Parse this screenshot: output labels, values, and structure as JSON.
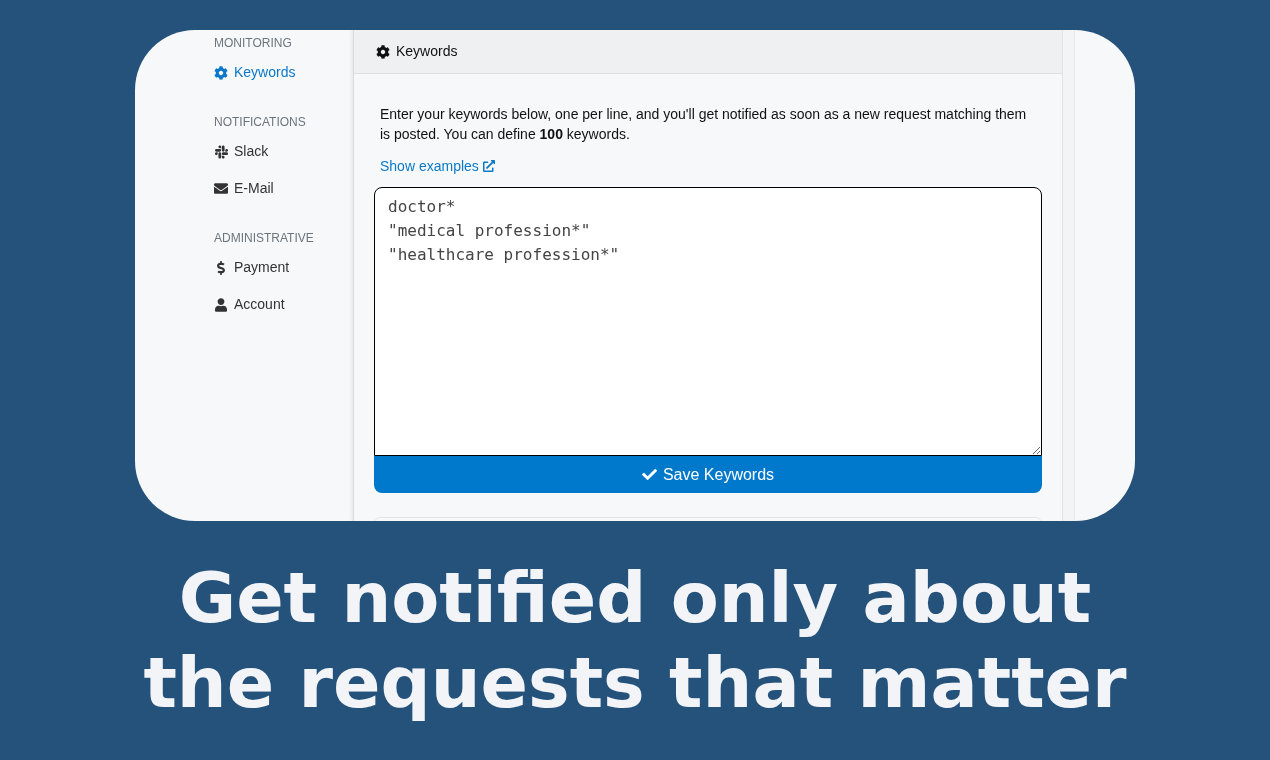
{
  "sidebar": {
    "sections": [
      {
        "heading": "MONITORING",
        "items": [
          {
            "label": "Keywords",
            "selected": true
          }
        ]
      },
      {
        "heading": "NOTIFICATIONS",
        "items": [
          {
            "label": "Slack",
            "selected": false
          },
          {
            "label": "E-Mail",
            "selected": false
          }
        ]
      },
      {
        "heading": "ADMINISTRATIVE",
        "items": [
          {
            "label": "Payment",
            "selected": false
          },
          {
            "label": "Account",
            "selected": false
          }
        ]
      }
    ]
  },
  "panel": {
    "title": "Keywords",
    "intro": "Enter your keywords below, one per line, and you'll get notified as soon as a new request matching them is posted. You can define **100** keywords.",
    "link": "Show examples",
    "keywords_field": {
      "lines": [
        "doctor*",
        "\"medical profession*\"",
        "\"healthcare profession*\""
      ]
    },
    "save_button": "Save Keywords"
  },
  "headline": [
    "Get notified only about",
    "the requests that matter"
  ]
}
